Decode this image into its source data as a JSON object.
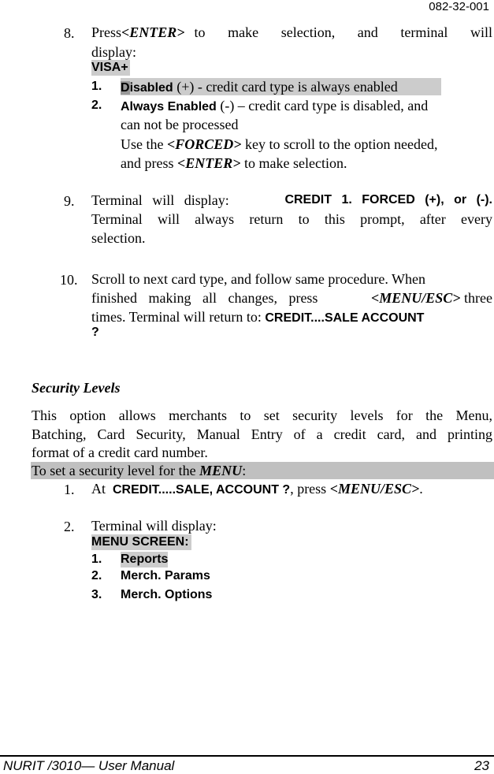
{
  "header": {
    "doc_number": "082-32-001"
  },
  "step8": {
    "num": "8.",
    "line1_a": "Press",
    "line1_key": "<ENTER>",
    "line1_b": "to make selection, and terminal will",
    "line2": "display:",
    "screen_title": "VISA+",
    "options": [
      {
        "num": "1.",
        "label_first": "D",
        "label_rest": "isabled",
        "desc": " (+) - credit card type is always enabled"
      },
      {
        "num": "2.",
        "label": "Always Enabled",
        "desc_line1": " (-) – credit card type is disabled, and",
        "desc_line2": "can not be processed"
      }
    ],
    "use_a": "Use the ",
    "use_key": "<FORCED>",
    "use_b": " key to scroll to the option needed,",
    "and_a": "and press ",
    "and_key": "<ENTER>",
    "and_b": " to make selection."
  },
  "step9": {
    "num": "9.",
    "line1_a": "Terminal will display:",
    "line1_screen": "CREDIT 1. FORCED (+), or (-).",
    "line2": "Terminal will always return to this prompt, after every",
    "line3": "selection."
  },
  "step10": {
    "num": "10.",
    "line1": "Scroll to next card type, and follow same procedure.  When",
    "line2_a": "finished making all changes, press ",
    "line2_key": "<MENU/ESC>",
    "line2_b": " three",
    "line3_a": "times.  Terminal will return to: ",
    "line3_screen": "CREDIT....SALE ACCOUNT",
    "line4_screen": "?"
  },
  "security": {
    "heading": "Security Levels",
    "para_line1": "This option allows merchants to set security levels for the Menu,",
    "para_line2": "Batching, Card Security, Manual Entry of a credit card, and printing",
    "para_line3": "format of a credit card number.",
    "bar_a": "To set a security level for the ",
    "bar_key": "MENU",
    "bar_b": ":",
    "step1": {
      "num": "1.",
      "a": "At  ",
      "screen": "CREDIT.....SALE, ACCOUNT ?",
      "b": ", press ",
      "key": "<MENU/ESC>",
      "c": "."
    },
    "step2": {
      "num": "2.",
      "text": "Terminal will display:",
      "screen_title": "MENU SCREEN:",
      "menu": [
        {
          "num": "1.",
          "label": "Reports"
        },
        {
          "num": "2.",
          "label": "Merch. Params"
        },
        {
          "num": "3.",
          "label": "Merch. Options"
        }
      ]
    }
  },
  "footer": {
    "title": "NURIT /3010— User Manual",
    "page": "23"
  }
}
